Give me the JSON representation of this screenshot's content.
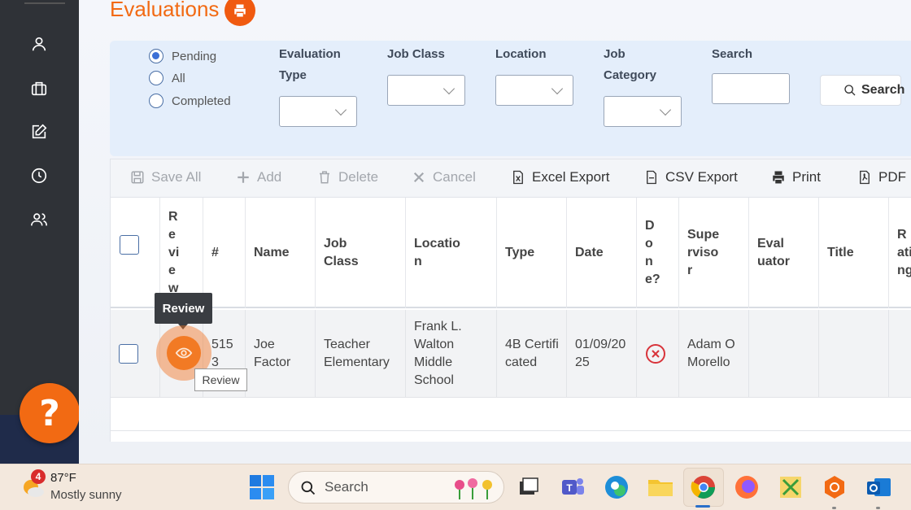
{
  "page": {
    "title": "Evaluations"
  },
  "sidebar": {
    "items": [
      {
        "icon": "user-icon"
      },
      {
        "icon": "briefcase-icon"
      },
      {
        "icon": "edit-icon"
      },
      {
        "icon": "clock-icon"
      },
      {
        "icon": "users-icon"
      }
    ],
    "help_label": "?"
  },
  "filters": {
    "status_options": [
      "Pending",
      "All",
      "Completed"
    ],
    "selected_status": "Pending",
    "evaluation_type_label": "Evaluation Type",
    "job_class_label": "Job Class",
    "location_label": "Location",
    "job_category_label": "Job Category",
    "search_label": "Search",
    "search_value": "",
    "search_button": "Search"
  },
  "toolbar": {
    "save_all": "Save All",
    "add": "Add",
    "delete": "Delete",
    "cancel": "Cancel",
    "excel_export": "Excel Export",
    "csv_export": "CSV Export",
    "print": "Print",
    "pdf": "PDF"
  },
  "grid": {
    "columns": {
      "review": "Review",
      "number": "#",
      "name": "Name",
      "job_class": "Job Class",
      "location": "Location",
      "type": "Type",
      "date": "Date",
      "done": "Done?",
      "supervisor": "Supervisor",
      "evaluator": "Evaluator",
      "title": "Title",
      "rating": "Rating"
    },
    "rows": [
      {
        "number": "5153",
        "name": "Joe Factor",
        "job_class": "Teacher Elementary",
        "location": "Frank L. Walton Middle School",
        "type": "4B Certificated",
        "date": "01/09/2025",
        "done": "no",
        "supervisor": "Adam O Morello",
        "evaluator": "",
        "title": "",
        "rating": ""
      }
    ]
  },
  "tooltips": {
    "review_dark": "Review",
    "review_light": "Review"
  },
  "taskbar": {
    "weather_temp": "87°F",
    "weather_desc": "Mostly sunny",
    "weather_badge": "4",
    "search_placeholder": "Search",
    "apps": [
      "start-icon",
      "file-explorer-icon",
      "teams-icon",
      "edge-icon",
      "folder-icon",
      "chrome-icon",
      "firefox-icon",
      "tools-icon",
      "security-icon",
      "outlook-icon"
    ]
  },
  "colors": {
    "accent": "#f26a13",
    "sidebar": "#2f3237",
    "filter_panel": "#e4eefb"
  }
}
